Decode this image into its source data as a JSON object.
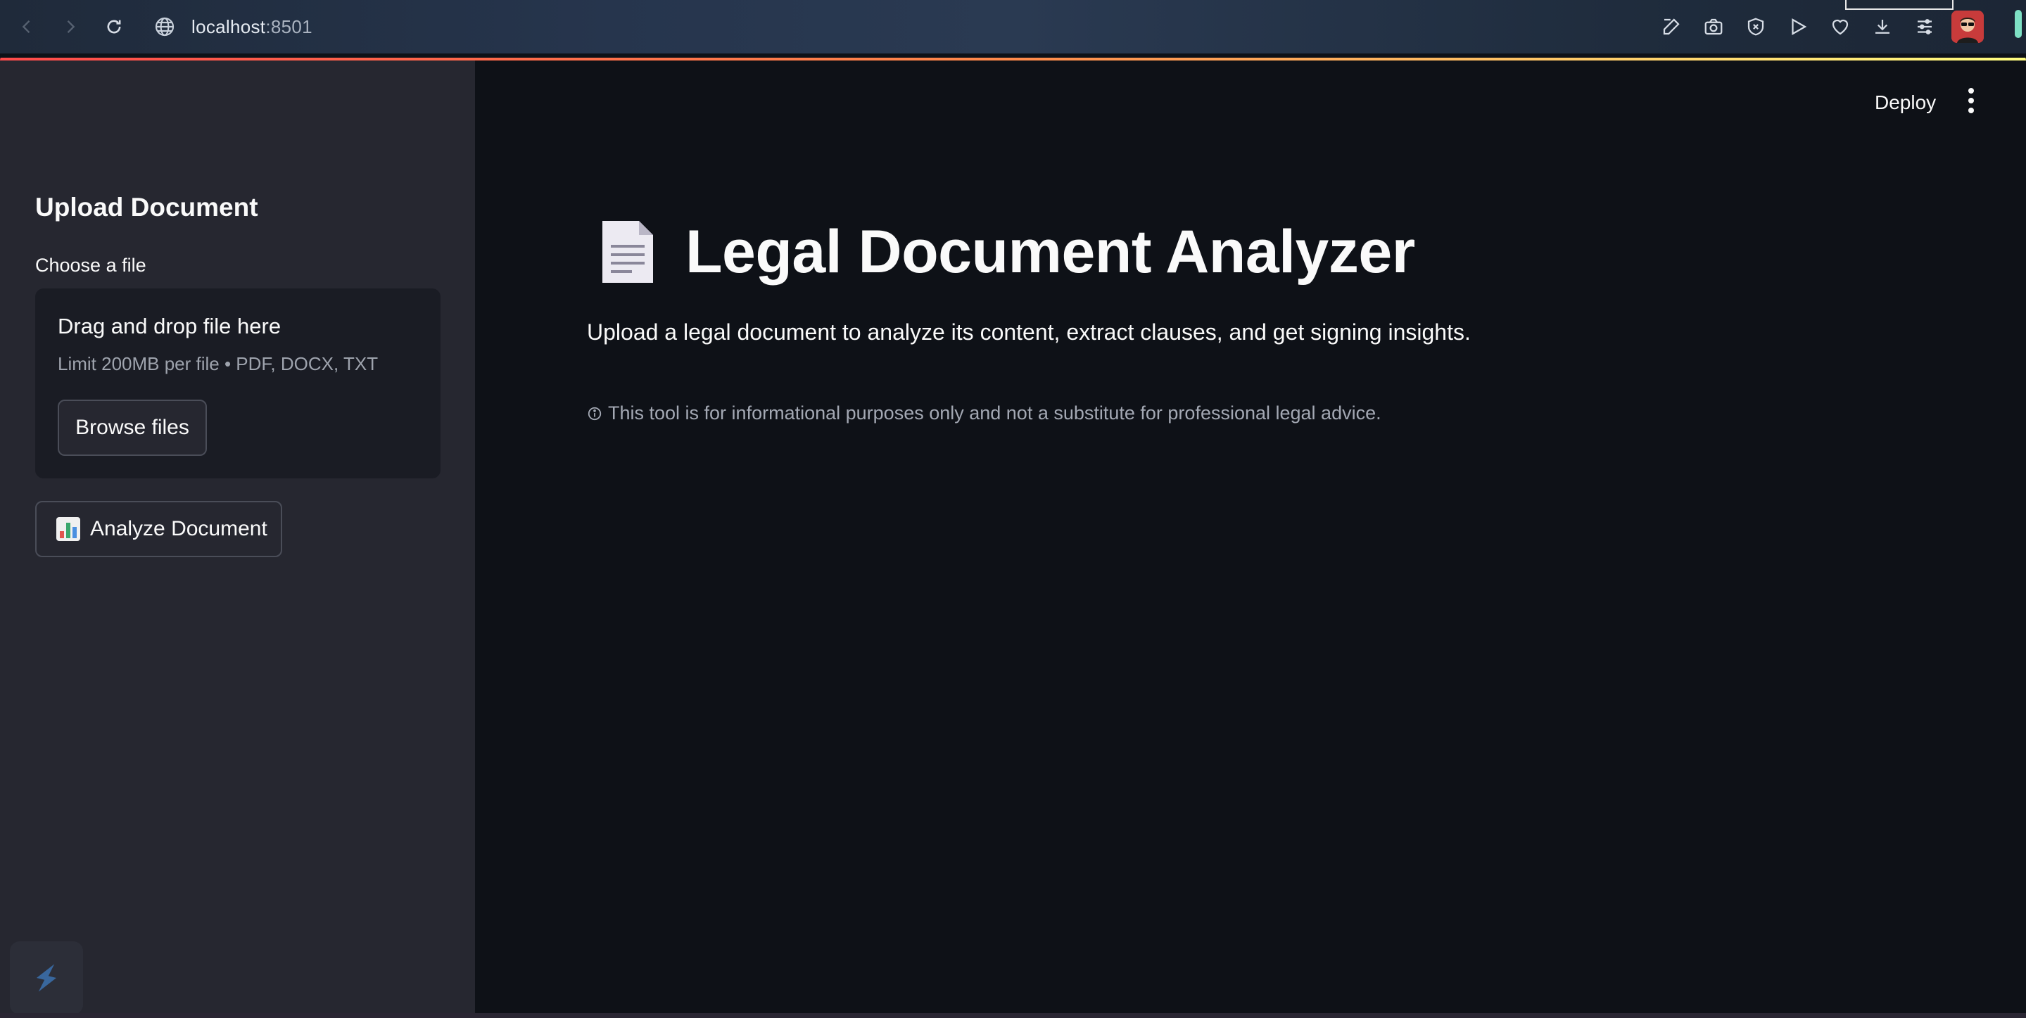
{
  "browser": {
    "url_host": "localhost",
    "url_port": ":8501",
    "icons": [
      "back-icon",
      "forward-icon",
      "reload-icon",
      "globe-icon",
      "edit-icon",
      "camera-icon",
      "shield-icon",
      "play-icon",
      "heart-icon",
      "download-icon",
      "settings-icon",
      "profile-avatar"
    ]
  },
  "sidebar": {
    "heading": "Upload Document",
    "file_label": "Choose a file",
    "dropzone_title": "Drag and drop file here",
    "dropzone_limit": "Limit 200MB per file • PDF, DOCX, TXT",
    "browse_label": "Browse files",
    "analyze_label": "Analyze Document",
    "analyze_icon": "bar-chart-emoji"
  },
  "header": {
    "deploy_label": "Deploy",
    "menu_icon": "vertical-dots-icon"
  },
  "main": {
    "title_icon": "document-emoji",
    "title": "Legal Document Analyzer",
    "subtitle": "Upload a legal document to analyze its content, extract clauses, and get signing insights.",
    "disclaimer": "This tool is for informational purposes only and not a substitute for professional legal advice.",
    "disclaimer_icon": "info-icon"
  },
  "colors": {
    "background": "#0e1117",
    "sidebar": "#262730",
    "dropzone": "#1a1c24",
    "text": "#fafafa",
    "muted_text": "#a3a8b3",
    "accent_gradient_start": "#ff4b4b",
    "accent_gradient_end": "#fffd80"
  }
}
